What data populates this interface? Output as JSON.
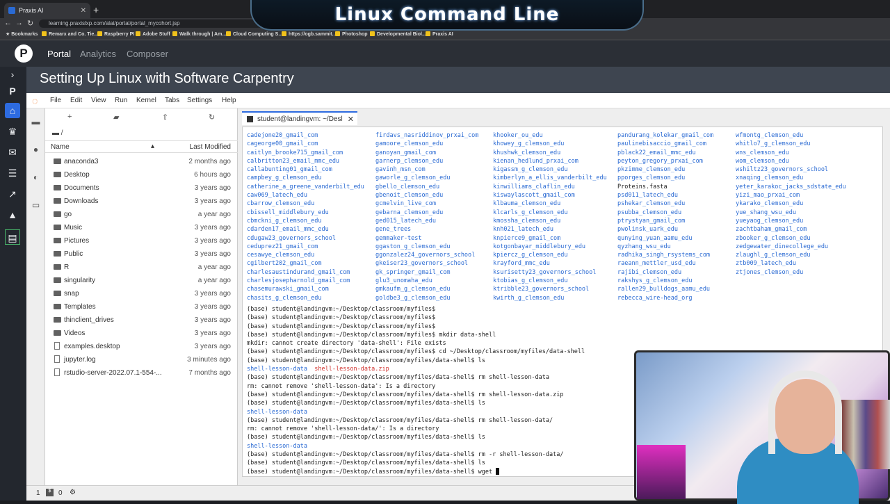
{
  "browser": {
    "tab_title": "Praxis AI",
    "url": "learning.praxislxp.com/alai/portal/portal_mycohort.jsp",
    "bookmarks": [
      "Bookmarks",
      "Remarx and Co. Tie...",
      "Raspberry PI",
      "Adobe Stuff",
      "Walk through | Am...",
      "Cloud Computing S...",
      "https://ogb.sammit...",
      "Photoshop",
      "Developmental Biol...",
      "Praxis AI"
    ]
  },
  "banner": {
    "title": "Linux Command Line"
  },
  "praxis": {
    "logo": "P",
    "nav": [
      "Portal",
      "Analytics",
      "Composer"
    ]
  },
  "page": {
    "title": "Setting Up Linux with Software Carpentry"
  },
  "jupyter": {
    "menu": [
      "File",
      "Edit",
      "View",
      "Run",
      "Kernel",
      "Tabs",
      "Settings",
      "Help"
    ],
    "breadcrumb": "/",
    "headers": {
      "name": "Name",
      "modified": "Last Modified"
    },
    "files": [
      {
        "name": "anaconda3",
        "modified": "2 months ago",
        "type": "folder"
      },
      {
        "name": "Desktop",
        "modified": "6 hours ago",
        "type": "folder"
      },
      {
        "name": "Documents",
        "modified": "3 years ago",
        "type": "folder"
      },
      {
        "name": "Downloads",
        "modified": "3 years ago",
        "type": "folder"
      },
      {
        "name": "go",
        "modified": "a year ago",
        "type": "folder"
      },
      {
        "name": "Music",
        "modified": "3 years ago",
        "type": "folder"
      },
      {
        "name": "Pictures",
        "modified": "3 years ago",
        "type": "folder"
      },
      {
        "name": "Public",
        "modified": "3 years ago",
        "type": "folder"
      },
      {
        "name": "R",
        "modified": "a year ago",
        "type": "folder"
      },
      {
        "name": "singularity",
        "modified": "a year ago",
        "type": "folder"
      },
      {
        "name": "snap",
        "modified": "3 years ago",
        "type": "folder"
      },
      {
        "name": "Templates",
        "modified": "3 years ago",
        "type": "folder"
      },
      {
        "name": "thinclient_drives",
        "modified": "3 years ago",
        "type": "folder"
      },
      {
        "name": "Videos",
        "modified": "3 years ago",
        "type": "folder"
      },
      {
        "name": "examples.desktop",
        "modified": "3 years ago",
        "type": "file"
      },
      {
        "name": "jupyter.log",
        "modified": "3 minutes ago",
        "type": "file"
      },
      {
        "name": "rstudio-server-2022.07.1-554-...",
        "modified": "7 months ago",
        "type": "file"
      }
    ],
    "terminal_tab": "student@landingvm: ~/Desl",
    "status": [
      "1",
      "0"
    ]
  },
  "terminal": {
    "columns": [
      [
        "cadejone20_gmail_com",
        "cageorge00_gmail_com",
        "caitlyn_brooke715_gmail_com",
        "calbritton23_email_mmc_edu",
        "callabunting01_gmail_com",
        "campbey_g_clemson_edu",
        "catherine_a_greene_vanderbilt_edu",
        "caw069_latech_edu",
        "cbarrow_clemson_edu",
        "cbissell_middlebury_edu",
        "cbmckni_g_clemson_edu",
        "cdarden17_email_mmc_edu",
        "cdugaw23_governors_school",
        "ceduprez21_gmail_com",
        "cesawye_clemson_edu",
        "cgilbert202_gmail_com",
        "charlesaustindurand_gmail_com",
        "charlesjosepharnold_gmail_com",
        "chasemurawski_gmail_com",
        "chasits_g_clemson_edu"
      ],
      [
        "firdavs_nasriddinov_prxai_com",
        "gamoore_clemson_edu",
        "ganoyan_gmail_com",
        "garnerp_clemson_edu",
        "gavinh_msn_com",
        "gaworle_g_clemson_edu",
        "gbello_clemson_edu",
        "gbenoit_clemson_edu",
        "gcmelvin_live_com",
        "gebarna_clemson_edu",
        "ged015_latech_edu",
        "gene_trees",
        "gemmaker-test",
        "ggaston_g_clemson_edu",
        "ggonzalez24_governors_school",
        "gkeiser23_governors_school",
        "gk_springer_gmail_com",
        "glu3_unomaha_edu",
        "gmkaufm_g_clemson_edu",
        "goldbe3_g_clemson_edu"
      ],
      [
        "khooker_ou_edu",
        "khowey_g_clemson_edu",
        "khushwk_clemson_edu",
        "kienan_hedlund_prxai_com",
        "kigassm_g_clemson_edu",
        "kimberlyn_a_ellis_vanderbilt_edu",
        "kinwilliams_claflin_edu",
        "kiswaylascott_gmail_com",
        "klbauma_clemson_edu",
        "klcarls_g_clemson_edu",
        "kmossha_clemson_edu",
        "knh021_latech_edu",
        "knpierce9_gmail_com",
        "kotgonbayar_middlebury_edu",
        "kpiercz_g_clemson_edu",
        "krayford_mmc_edu",
        "ksurisetty23_governors_school",
        "ktobias_g_clemson_edu",
        "ktribble23_governors_school",
        "kwirth_g_clemson_edu"
      ],
      [
        "pandurang_kolekar_gmail_com",
        "paulinebisaccio_gmail_com",
        "pblack22_email_mmc_edu",
        "peyton_gregory_prxai_com",
        "pkzimme_clemson_edu",
        "pporges_clemson_edu",
        "Proteins.fasta",
        "psd011_latech_edu",
        "pshekar_clemson_edu",
        "psubba_clemson_edu",
        "ptrystyan_gmail_com",
        "pwolinsk_uark_edu",
        "qunying_yuan_aamu_edu",
        "qyzhang_wsu_edu",
        "radhika_singh_rsystems_com",
        "raeann_mettler_usd_edu",
        "rajibi_clemson_edu",
        "rakshys_g_clemson_edu",
        "rallen29_bulldogs_aamu_edu",
        "rebecca_wire-head_org"
      ],
      [
        "wfmontg_clemson_edu",
        "whitlo7_g_clemson_edu",
        "wns_clemson_edu",
        "wom_clemson_edu",
        "wshiltz23_governors_school",
        "xnaqing_clemson_edu",
        "yeter_karakoc_jacks_sdstate_edu",
        "yizi_mao_prxai_com",
        "ykarako_clemson_edu",
        "yue_shang_wsu_edu",
        "yueyaog_clemson_edu",
        "zachtbaham_gmail_com",
        "zbooker_g_clemson_edu",
        "zedgewater_dinecollege_edu",
        "zlaughl_g_clemson_edu",
        "ztb009_latech_edu",
        "ztjones_clemson_edu"
      ]
    ],
    "lines": [
      "(base) student@landingvm:~/Desktop/classroom/myfiles$",
      "(base) student@landingvm:~/Desktop/classroom/myfiles$",
      "(base) student@landingvm:~/Desktop/classroom/myfiles$",
      "(base) student@landingvm:~/Desktop/classroom/myfiles$ mkdir data-shell",
      "mkdir: cannot create directory 'data-shell': File exists",
      "(base) student@landingvm:~/Desktop/classroom/myfiles$ cd ~/Desktop/classroom/myfiles/data-shell",
      "(base) student@landingvm:~/Desktop/classroom/myfiles/data-shell$ ls",
      "(base) student@landingvm:~/Desktop/classroom/myfiles/data-shell$ rm shell-lesson-data",
      "rm: cannot remove 'shell-lesson-data': Is a directory",
      "(base) student@landingvm:~/Desktop/classroom/myfiles/data-shell$ rm shell-lesson-data.zip",
      "(base) student@landingvm:~/Desktop/classroom/myfiles/data-shell$ ls",
      "(base) student@landingvm:~/Desktop/classroom/myfiles/data-shell$ rm shell-lesson-data/",
      "rm: cannot remove 'shell-lesson-data/': Is a directory",
      "(base) student@landingvm:~/Desktop/classroom/myfiles/data-shell$ ls",
      "(base) student@landingvm:~/Desktop/classroom/myfiles/data-shell$ rm -r shell-lesson-data/",
      "(base) student@landingvm:~/Desktop/classroom/myfiles/data-shell$ ls",
      "(base) student@landingvm:~/Desktop/classroom/myfiles/data-shell$ wget "
    ],
    "ls_out1_a": "shell-lesson-data",
    "ls_out1_b": "shell-lesson-data.zip",
    "ls_out2": "shell-lesson-data",
    "ls_out3": "shell-lesson-data"
  },
  "colors": {
    "accent": "#2d6be0",
    "link_blue": "#2a6ad3",
    "zip_red": "#d0312d"
  }
}
